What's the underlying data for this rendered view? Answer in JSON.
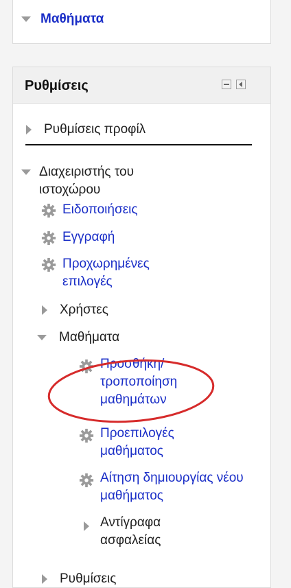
{
  "courses_block": {
    "label": "Μαθήματα"
  },
  "settings": {
    "title": "Ρυθμίσεις",
    "profile_settings": "Ρυθμίσεις προφίλ",
    "site_admin": "Διαχειριστής του ιστοχώρου",
    "notifications": "Ειδοποιήσεις",
    "registration": "Εγγραφή",
    "advanced_options": "Προχωρημένες επιλογές",
    "users": "Χρήστες",
    "courses": "Μαθήματα",
    "add_edit_courses": "Προσθήκη/ τροποποίηση μαθημάτων",
    "course_defaults": "Προεπιλογές μαθήματος",
    "course_request": "Αίτηση δημιουργίας νέου μαθήματος",
    "backups": "Αντίγραφα ασφαλείας",
    "cut_off": "Ρυθμίσεις"
  },
  "colors": {
    "link": "#1a2ec7",
    "highlight": "#d62b2b"
  }
}
